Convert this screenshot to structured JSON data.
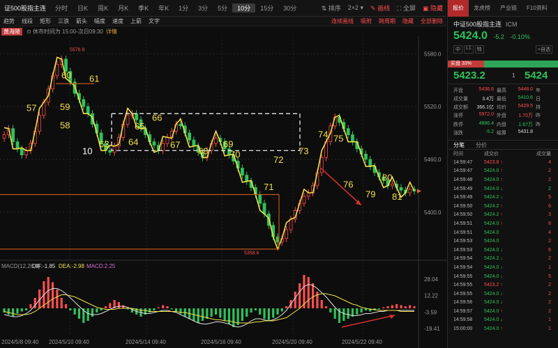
{
  "toolbar": {
    "title": "证500股指主连",
    "periods": [
      "分时",
      "日K",
      "周K",
      "月K",
      "季K",
      "年K",
      "1分",
      "3分",
      "5分",
      "10分",
      "15分",
      "30分"
    ],
    "active_period": "10分",
    "sort_label": "排序",
    "layout_label": "2×2",
    "draw_label": "画线",
    "fullscreen_label": "全屏",
    "hide_label": "隐藏"
  },
  "drawbar": {
    "tools": [
      "趋势",
      "线段",
      "矩形",
      "三浪",
      "箭头",
      "幅度",
      "速度",
      "上箭",
      "文字"
    ],
    "right_tools": [
      "连续画线",
      "吸附",
      "跨周期",
      "隐藏",
      "全部删除"
    ]
  },
  "infobar": {
    "badge": "黄海陵",
    "rest_text": "休市时间为 15:00-次日09:30",
    "detail_link": "详情"
  },
  "chart_data": {
    "type": "candlestick",
    "price_ticks": [
      "5580.0",
      "5520.0",
      "5460.0",
      "5400.0"
    ],
    "price_tick_values": [
      5580,
      5520,
      5460,
      5400
    ],
    "ylim": [
      5350,
      5600
    ],
    "high_label": "5576.8",
    "low_label": "5358.6",
    "x_labels": [
      "2024/5/8 09:40",
      "2024/5/10 09:40",
      "2024/5/14 09:40",
      "2024/5/16 09:40",
      "2024/5/20 09:40",
      "2024/5/22 09:40"
    ],
    "close_series": [
      5488,
      5495,
      5480,
      5472,
      5465,
      5470,
      5478,
      5492,
      5510,
      5525,
      5540,
      5555,
      5568,
      5574,
      5560,
      5548,
      5535,
      5528,
      5520,
      5512,
      5500,
      5490,
      5478,
      5470,
      5468,
      5475,
      5485,
      5500,
      5510,
      5512,
      5505,
      5495,
      5488,
      5480,
      5476,
      5470,
      5478,
      5485,
      5492,
      5500,
      5498,
      5490,
      5482,
      5475,
      5468,
      5462,
      5470,
      5478,
      5484,
      5480,
      5472,
      5465,
      5458,
      5450,
      5442,
      5435,
      5428,
      5420,
      5410,
      5398,
      5385,
      5372,
      5366,
      5370,
      5380,
      5392,
      5402,
      5410,
      5418,
      5422,
      5430,
      5445,
      5462,
      5480,
      5498,
      5508,
      5502,
      5495,
      5488,
      5480,
      5472,
      5466,
      5460,
      5452,
      5445,
      5440,
      5436,
      5430,
      5432,
      5428,
      5425,
      5422,
      5426,
      5424
    ],
    "wave_labels": [
      {
        "text": "57",
        "color": "yellow"
      },
      {
        "text": "60",
        "color": "yellow"
      },
      {
        "text": "61",
        "color": "yellow"
      },
      {
        "text": "59",
        "color": "yellow"
      },
      {
        "text": "58",
        "color": "yellow"
      },
      {
        "text": "10",
        "color": "white"
      },
      {
        "text": "63",
        "color": "yellow"
      },
      {
        "text": "64",
        "color": "yellow"
      },
      {
        "text": "65",
        "color": "yellow"
      },
      {
        "text": "66",
        "color": "yellow"
      },
      {
        "text": "67",
        "color": "yellow"
      },
      {
        "text": "68",
        "color": "yellow"
      },
      {
        "text": "69",
        "color": "yellow"
      },
      {
        "text": "70",
        "color": "yellow"
      },
      {
        "text": "71",
        "color": "yellow"
      },
      {
        "text": "72",
        "color": "yellow"
      },
      {
        "text": "73",
        "color": "yellow"
      },
      {
        "text": "74",
        "color": "yellow"
      },
      {
        "text": "75",
        "color": "yellow"
      },
      {
        "text": "76",
        "color": "yellow"
      },
      {
        "text": "79",
        "color": "yellow"
      },
      {
        "text": "80",
        "color": "yellow"
      },
      {
        "text": "81",
        "color": "yellow"
      }
    ],
    "macd": {
      "label": "MACD(12,26,9)",
      "dif": "DIF:-1.85",
      "dea": "DEA:-2.98",
      "macd": "MACD:2.25",
      "ticks": [
        "28.04",
        "12.22",
        "-3.59",
        "-19.41"
      ],
      "tick_values": [
        28.04,
        12.22,
        -3.59,
        -19.41
      ],
      "ylim": [
        -26,
        34
      ],
      "hist": [
        -4,
        -6,
        -8,
        -5,
        -3,
        -2,
        4,
        10,
        18,
        26,
        30,
        25,
        18,
        10,
        4,
        -2,
        -6,
        -10,
        -14,
        -12,
        -8,
        -4,
        -2,
        2,
        5,
        8,
        6,
        3,
        -1,
        -4,
        -6,
        -8,
        -6,
        -4,
        -2,
        1,
        3,
        2,
        -1,
        -3,
        -5,
        -8,
        -10,
        -12,
        -14,
        -12,
        -10,
        -8,
        -6,
        -9,
        -12,
        -15,
        -18,
        -16,
        -12,
        -8,
        -4,
        -2,
        -6,
        -10,
        -12,
        -9,
        -6,
        -3,
        2,
        8,
        16,
        24,
        32,
        30,
        24,
        16,
        8,
        2,
        -4,
        -10,
        -14,
        -12,
        -10,
        -8,
        -6,
        -4,
        -2,
        -3,
        -2,
        -1,
        1,
        2,
        3,
        4,
        3,
        2,
        3,
        2
      ],
      "dif_series": [
        -6,
        -7,
        -8,
        -8,
        -7,
        -5,
        -2,
        3,
        8,
        13,
        17,
        19,
        19,
        17,
        14,
        10,
        6,
        2,
        -2,
        -5,
        -6,
        -6,
        -5,
        -3,
        -1,
        1,
        2,
        2,
        1,
        -1,
        -3,
        -4,
        -5,
        -5,
        -4,
        -3,
        -2,
        -2,
        -3,
        -4,
        -6,
        -8,
        -10,
        -12,
        -14,
        -15,
        -15,
        -14,
        -13,
        -13,
        -14,
        -15,
        -17,
        -18,
        -17,
        -15,
        -12,
        -10,
        -10,
        -11,
        -12,
        -11,
        -9,
        -6,
        -2,
        4,
        10,
        16,
        21,
        23,
        22,
        19,
        15,
        11,
        6,
        1,
        -3,
        -5,
        -6,
        -7,
        -7,
        -6,
        -5,
        -5,
        -4,
        -3,
        -3,
        -2,
        -2,
        -2,
        -2,
        -2,
        -2,
        -2
      ],
      "dea_series": [
        -3,
        -4,
        -5,
        -6,
        -6,
        -6,
        -5,
        -3,
        0,
        3,
        6,
        9,
        11,
        13,
        13,
        12,
        11,
        9,
        7,
        5,
        3,
        1,
        0,
        -1,
        -1,
        -1,
        0,
        0,
        0,
        0,
        -1,
        -2,
        -2,
        -3,
        -3,
        -3,
        -3,
        -3,
        -3,
        -3,
        -4,
        -4,
        -5,
        -6,
        -7,
        -8,
        -9,
        -10,
        -11,
        -11,
        -12,
        -12,
        -13,
        -14,
        -14,
        -14,
        -14,
        -13,
        -13,
        -12,
        -12,
        -12,
        -11,
        -10,
        -9,
        -6,
        -3,
        0,
        4,
        8,
        11,
        13,
        14,
        14,
        13,
        12,
        10,
        8,
        6,
        4,
        3,
        1,
        0,
        -1,
        -1,
        -2,
        -2,
        -2,
        -2,
        -2,
        -3,
        -3,
        -3,
        -3
      ]
    }
  },
  "panel": {
    "tabs": [
      "报价",
      "龙虎榜",
      "产业链",
      "F10资料"
    ],
    "name": "中证500股指主连",
    "code": "ICM",
    "price": "5424.0",
    "change": "-5.2",
    "change_pct": "-0.10%",
    "btns": [
      "中",
      "L1",
      "特"
    ],
    "right_btn": "+自选",
    "buy_label": "买盘",
    "buy_pct": "33%",
    "bid": "5423.2",
    "bid_qty": "1",
    "ask": "5424",
    "stats": [
      {
        "k": "开盘",
        "v": "5436.6",
        "c": "red",
        "k2": "最高",
        "v2": "5448.0",
        "c2": "red",
        "u": "年"
      },
      {
        "k": "成交量",
        "v": "3.4万",
        "c": "",
        "k2": "最低",
        "v2": "5410.6",
        "c2": "green",
        "u": "日"
      },
      {
        "k": "成交额",
        "v": "366.1亿",
        "c": "",
        "k2": "均价",
        "v2": "5429.5",
        "c2": "red",
        "u": "持"
      },
      {
        "k": "涨停",
        "v": "5972.0",
        "c": "red",
        "k2": "外盘",
        "v2": "1.70万",
        "c2": "red",
        "u": "昨"
      },
      {
        "k": "跌停",
        "v": "4886.4",
        "c": "green",
        "k2": "内盘",
        "v2": "1.67万",
        "c2": "green",
        "u": "昨"
      },
      {
        "k": "涨跌",
        "v": "-5.2",
        "c": "green",
        "k2": "结算",
        "v2": "5431.8",
        "c2": "",
        "u": ""
      }
    ],
    "trade_tabs": [
      "分笔",
      "分价"
    ],
    "trade_head": [
      "时间",
      "成交价",
      "成交量"
    ],
    "trades": [
      {
        "t": "14:59:47",
        "p": "5423.8",
        "arrow": "↑",
        "pc": "red",
        "v": "4",
        "vc": "red"
      },
      {
        "t": "14:59:47",
        "p": "5424.0",
        "arrow": "↑",
        "pc": "green",
        "v": "2",
        "vc": "red"
      },
      {
        "t": "14:59:48",
        "p": "5424.0",
        "arrow": "↑",
        "pc": "green",
        "v": "2",
        "vc": "red"
      },
      {
        "t": "14:59:49",
        "p": "5424.0",
        "arrow": "↓",
        "pc": "green",
        "v": "2",
        "vc": "green"
      },
      {
        "t": "14:59:49",
        "p": "5424.2",
        "arrow": "↓",
        "pc": "green",
        "v": "5",
        "vc": "red"
      },
      {
        "t": "14:59:50",
        "p": "5424.2",
        "arrow": "↑",
        "pc": "green",
        "v": "6",
        "vc": "red"
      },
      {
        "t": "14:59:50",
        "p": "5424.2",
        "arrow": "↑",
        "pc": "green",
        "v": "3",
        "vc": "red"
      },
      {
        "t": "14:59:51",
        "p": "5424.0",
        "arrow": "↑",
        "pc": "green",
        "v": "8",
        "vc": "red"
      },
      {
        "t": "14:59:51",
        "p": "5424.0",
        "arrow": "",
        "pc": "green",
        "v": "4",
        "vc": "red"
      },
      {
        "t": "14:59:53",
        "p": "5424.0",
        "arrow": "",
        "pc": "green",
        "v": "2",
        "vc": "red"
      },
      {
        "t": "14:59:53",
        "p": "5424.0",
        "arrow": "↓",
        "pc": "green",
        "v": "6",
        "vc": "red"
      },
      {
        "t": "14:59:54",
        "p": "5424.2",
        "arrow": "↓",
        "pc": "green",
        "v": "2",
        "vc": "red"
      },
      {
        "t": "14:59:54",
        "p": "5424.0",
        "arrow": "↓",
        "pc": "green",
        "v": "1",
        "vc": "red"
      },
      {
        "t": "14:59:55",
        "p": "5424.0",
        "arrow": "↓",
        "pc": "green",
        "v": "5",
        "vc": "red"
      },
      {
        "t": "14:59:55",
        "p": "5423.2",
        "arrow": "↑",
        "pc": "red",
        "v": "2",
        "vc": "red"
      },
      {
        "t": "14:59:55",
        "p": "5424.0",
        "arrow": "↓",
        "pc": "green",
        "v": "2",
        "vc": "red"
      },
      {
        "t": "14:59:56",
        "p": "5424.0",
        "arrow": "↓",
        "pc": "green",
        "v": "2",
        "vc": "red"
      },
      {
        "t": "14:59:57",
        "p": "5424.0",
        "arrow": "↑",
        "pc": "green",
        "v": "2",
        "vc": "red"
      },
      {
        "t": "14:59:58",
        "p": "5424.0",
        "arrow": "↓",
        "pc": "green",
        "v": "1",
        "vc": "red"
      },
      {
        "t": "15:00:00",
        "p": "5424.0",
        "arrow": "↑",
        "pc": "green",
        "v": "1",
        "vc": "red"
      }
    ]
  }
}
